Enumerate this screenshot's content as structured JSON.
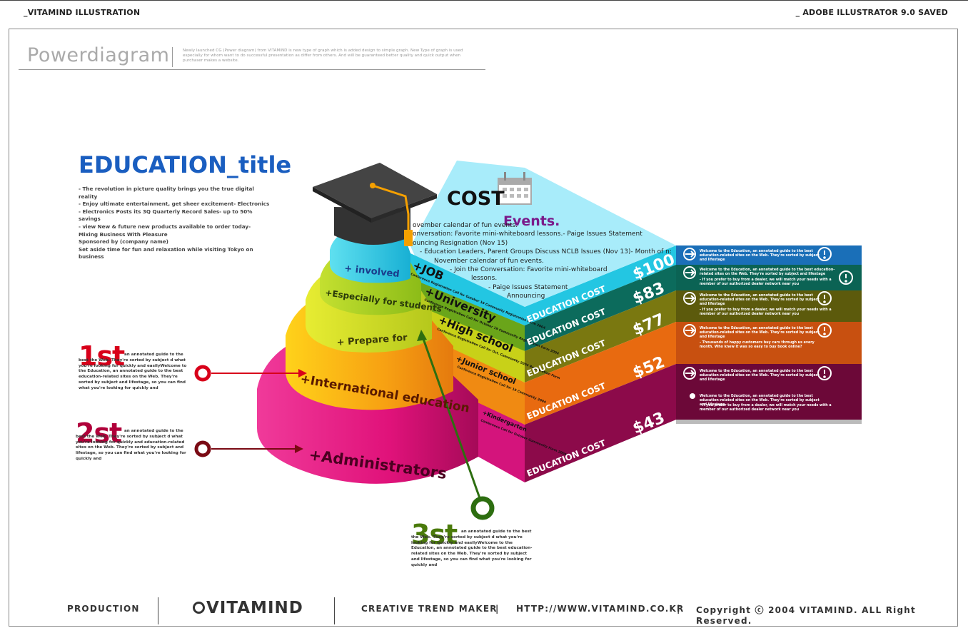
{
  "header": {
    "left": "_VITAMIND ILLUSTRATION",
    "right": "_ ADOBE ILLUSTRATOR 9.0 SAVED"
  },
  "powerdiagram": {
    "title": "Powerdiagram",
    "desc": "Newly launched CG (Power diagram) from VITAMIND is new type of graph which is added design to simple graph. New Type of graph is used especially for whom want to do successful presentation as differ from others. And will be guaranteed better quality and quick output when purchaser makes a website."
  },
  "education": {
    "title": "EDUCATION_title",
    "lines": [
      "- The revolution in picture quality brings you the true digital reality",
      "- Enjoy ultimate entertainment, get sheer excitement- Electronics",
      "- Electronics Posts its 3Q Quarterly Record Sales- up to 50% savings",
      "- view New & future new products available to order today- Mixing Business With Pleasure",
      "Sponsored by (company name)",
      "Set aside time for fun and relaxation while visiting Tokyo on business"
    ]
  },
  "ranks": [
    {
      "label": "1st",
      "color": "#d8001a",
      "text": "an annotated guide to the best the Web. They're sorted by subject d what you're looking for quickly and easilyWelcome to the Education, an annotated guide to the best education-related sites on the Web. They're sorted by subject and lifestage, so you can find what you're looking for quickly and"
    },
    {
      "label": "2st",
      "color": "#b0003a",
      "text": "an annotated guide to the best the Web. They're sorted by subject d what you're looking for quickly and education-related sites on the Web. They're sorted by subject and lifestage, so you can find what you're looking for quickly and"
    },
    {
      "label": "3st",
      "color": "#4a7a0a",
      "text": "an annotated guide to the best the Web. They're sorted by subject d what you're looking for quickly and easilyWelcome to the Education, an annotated guide to the best education-related sites on the Web. They're sorted by subject and lifestage, so you can find what you're looking for quickly and"
    }
  ],
  "tiers": [
    {
      "label": "+ involved",
      "color": "#21c3dd"
    },
    {
      "label": "+Especially for students",
      "color": "#a8cc22"
    },
    {
      "label": "+ Prepare for",
      "color": "#cfdc2c"
    },
    {
      "label": "+International education",
      "color": "#f59a12"
    },
    {
      "label": "+Administrators",
      "color": "#e81c8c"
    }
  ],
  "steps": [
    {
      "name": "+JOB",
      "color": "#23c6e2",
      "sub": "Conference Registration Call for October 19 Community Registration Form 2004"
    },
    {
      "name": "+University",
      "color": "#6aa51a",
      "sub": "Conference Registration Call for October 19 Community Registration Form 2004"
    },
    {
      "name": "+High school",
      "color": "#c8d118",
      "sub": "Conference Registration Call for Oct. Community 2004 Registration Form"
    },
    {
      "name": "+Junior school",
      "color": "#f08a12",
      "sub": "Conference Registration Call for 19 Community 2004"
    },
    {
      "name": "+Kindergarten",
      "color": "#d4147c",
      "sub": "Conference Call for October Community Form 2004"
    }
  ],
  "cost": {
    "label": "COST",
    "events": "Events.",
    "lines": [
      "ovember calendar of fun events.",
      "onversation: Favorite mini-whiteboard lessons.- Paige Issues Statement",
      "ouncing Resignation (Nov 15)",
      "- Education Leaders, Parent Groups Discuss NCLB Issues (Nov 13)- Month of n:",
      "November calendar of fun events.",
      "- Join the Conversation: Favorite mini-whiteboard",
      "lessons.",
      "- Paige Issues Statement",
      "Announcing"
    ]
  },
  "costs": [
    {
      "price": "$100",
      "label": "EDUCATION COST",
      "color": "#1a6fb8",
      "right_color": "#1a6fb8"
    },
    {
      "price": "$83",
      "label": "EDUCATION COST",
      "color": "#0c6b5c",
      "right_color": "#0b6354"
    },
    {
      "price": "$77",
      "label": "EDUCATION COST",
      "color": "#7a7810",
      "right_color": "#5c5a0c"
    },
    {
      "price": "$52",
      "label": "EDUCATION COST",
      "color": "#e86a10",
      "right_color": "#c85010"
    },
    {
      "price": "$43",
      "label": "EDUCATION COST",
      "color": "#8c0a4a",
      "right_color": "#6c0838"
    }
  ],
  "notes": [
    "Welcome to the Education, an annotated guide to the best education-related sites on the Web. They're sorted by subject and lifestage",
    "Welcome to the Education, an annotated guide to the best education-related sites on the Web. They're sorted by subject and lifestage",
    "- If you prefer to buy from a dealer, we will match your needs with a member of our authorized dealer network near you",
    "Welcome to the Education, an annotated guide to the best education-related sites on the Web. They're sorted by subject and lifestage",
    "- If you prefer to buy from a dealer, we will match your needs with a member of our authorized dealer network near you",
    "Welcome to the Education, an annotated guide to the best education-related sites on the Web. They're sorted by subject and lifestage",
    "- Thousands of happy customers buy cars through us every month. Who knew it was so easy to buy book online?",
    "Welcome to the Education, an annotated guide to the best education-related sites on the Web. They're sorted by subject and lifestage",
    "Welcome to the Education, an annotated guide to the best education-related sites on the Web. They're sorted by subject and lifestage",
    "- If you prefer to buy from a dealer, we will match your needs with a member of our authorized dealer network near you"
  ],
  "footer": {
    "production": "PRODUCTION",
    "logo": "VITAMIND",
    "tagline": "CREATIVE TREND MAKER",
    "sep": "|",
    "url": "HTTP://WWW.VITAMIND.CO.KR",
    "copyright": "Copyright ⓒ 2004 VITAMIND. ALL Right Reserved."
  }
}
